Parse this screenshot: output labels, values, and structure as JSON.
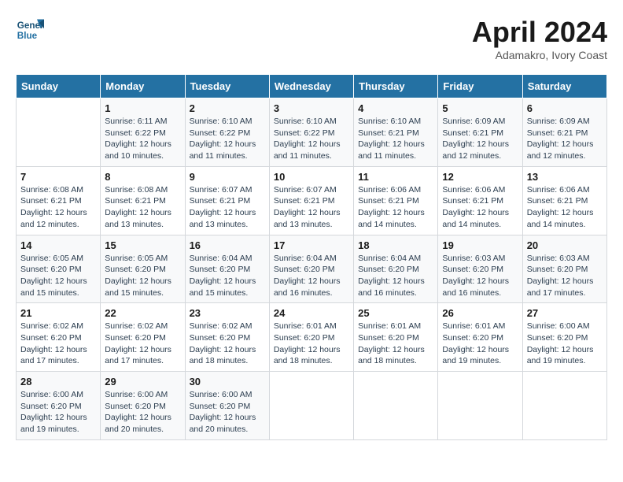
{
  "header": {
    "logo_line1": "General",
    "logo_line2": "Blue",
    "month_title": "April 2024",
    "location": "Adamakro, Ivory Coast"
  },
  "weekdays": [
    "Sunday",
    "Monday",
    "Tuesday",
    "Wednesday",
    "Thursday",
    "Friday",
    "Saturday"
  ],
  "weeks": [
    [
      {
        "day": "",
        "info": ""
      },
      {
        "day": "1",
        "info": "Sunrise: 6:11 AM\nSunset: 6:22 PM\nDaylight: 12 hours\nand 10 minutes."
      },
      {
        "day": "2",
        "info": "Sunrise: 6:10 AM\nSunset: 6:22 PM\nDaylight: 12 hours\nand 11 minutes."
      },
      {
        "day": "3",
        "info": "Sunrise: 6:10 AM\nSunset: 6:22 PM\nDaylight: 12 hours\nand 11 minutes."
      },
      {
        "day": "4",
        "info": "Sunrise: 6:10 AM\nSunset: 6:21 PM\nDaylight: 12 hours\nand 11 minutes."
      },
      {
        "day": "5",
        "info": "Sunrise: 6:09 AM\nSunset: 6:21 PM\nDaylight: 12 hours\nand 12 minutes."
      },
      {
        "day": "6",
        "info": "Sunrise: 6:09 AM\nSunset: 6:21 PM\nDaylight: 12 hours\nand 12 minutes."
      }
    ],
    [
      {
        "day": "7",
        "info": "Sunrise: 6:08 AM\nSunset: 6:21 PM\nDaylight: 12 hours\nand 12 minutes."
      },
      {
        "day": "8",
        "info": "Sunrise: 6:08 AM\nSunset: 6:21 PM\nDaylight: 12 hours\nand 13 minutes."
      },
      {
        "day": "9",
        "info": "Sunrise: 6:07 AM\nSunset: 6:21 PM\nDaylight: 12 hours\nand 13 minutes."
      },
      {
        "day": "10",
        "info": "Sunrise: 6:07 AM\nSunset: 6:21 PM\nDaylight: 12 hours\nand 13 minutes."
      },
      {
        "day": "11",
        "info": "Sunrise: 6:06 AM\nSunset: 6:21 PM\nDaylight: 12 hours\nand 14 minutes."
      },
      {
        "day": "12",
        "info": "Sunrise: 6:06 AM\nSunset: 6:21 PM\nDaylight: 12 hours\nand 14 minutes."
      },
      {
        "day": "13",
        "info": "Sunrise: 6:06 AM\nSunset: 6:21 PM\nDaylight: 12 hours\nand 14 minutes."
      }
    ],
    [
      {
        "day": "14",
        "info": "Sunrise: 6:05 AM\nSunset: 6:20 PM\nDaylight: 12 hours\nand 15 minutes."
      },
      {
        "day": "15",
        "info": "Sunrise: 6:05 AM\nSunset: 6:20 PM\nDaylight: 12 hours\nand 15 minutes."
      },
      {
        "day": "16",
        "info": "Sunrise: 6:04 AM\nSunset: 6:20 PM\nDaylight: 12 hours\nand 15 minutes."
      },
      {
        "day": "17",
        "info": "Sunrise: 6:04 AM\nSunset: 6:20 PM\nDaylight: 12 hours\nand 16 minutes."
      },
      {
        "day": "18",
        "info": "Sunrise: 6:04 AM\nSunset: 6:20 PM\nDaylight: 12 hours\nand 16 minutes."
      },
      {
        "day": "19",
        "info": "Sunrise: 6:03 AM\nSunset: 6:20 PM\nDaylight: 12 hours\nand 16 minutes."
      },
      {
        "day": "20",
        "info": "Sunrise: 6:03 AM\nSunset: 6:20 PM\nDaylight: 12 hours\nand 17 minutes."
      }
    ],
    [
      {
        "day": "21",
        "info": "Sunrise: 6:02 AM\nSunset: 6:20 PM\nDaylight: 12 hours\nand 17 minutes."
      },
      {
        "day": "22",
        "info": "Sunrise: 6:02 AM\nSunset: 6:20 PM\nDaylight: 12 hours\nand 17 minutes."
      },
      {
        "day": "23",
        "info": "Sunrise: 6:02 AM\nSunset: 6:20 PM\nDaylight: 12 hours\nand 18 minutes."
      },
      {
        "day": "24",
        "info": "Sunrise: 6:01 AM\nSunset: 6:20 PM\nDaylight: 12 hours\nand 18 minutes."
      },
      {
        "day": "25",
        "info": "Sunrise: 6:01 AM\nSunset: 6:20 PM\nDaylight: 12 hours\nand 18 minutes."
      },
      {
        "day": "26",
        "info": "Sunrise: 6:01 AM\nSunset: 6:20 PM\nDaylight: 12 hours\nand 19 minutes."
      },
      {
        "day": "27",
        "info": "Sunrise: 6:00 AM\nSunset: 6:20 PM\nDaylight: 12 hours\nand 19 minutes."
      }
    ],
    [
      {
        "day": "28",
        "info": "Sunrise: 6:00 AM\nSunset: 6:20 PM\nDaylight: 12 hours\nand 19 minutes."
      },
      {
        "day": "29",
        "info": "Sunrise: 6:00 AM\nSunset: 6:20 PM\nDaylight: 12 hours\nand 20 minutes."
      },
      {
        "day": "30",
        "info": "Sunrise: 6:00 AM\nSunset: 6:20 PM\nDaylight: 12 hours\nand 20 minutes."
      },
      {
        "day": "",
        "info": ""
      },
      {
        "day": "",
        "info": ""
      },
      {
        "day": "",
        "info": ""
      },
      {
        "day": "",
        "info": ""
      }
    ]
  ]
}
